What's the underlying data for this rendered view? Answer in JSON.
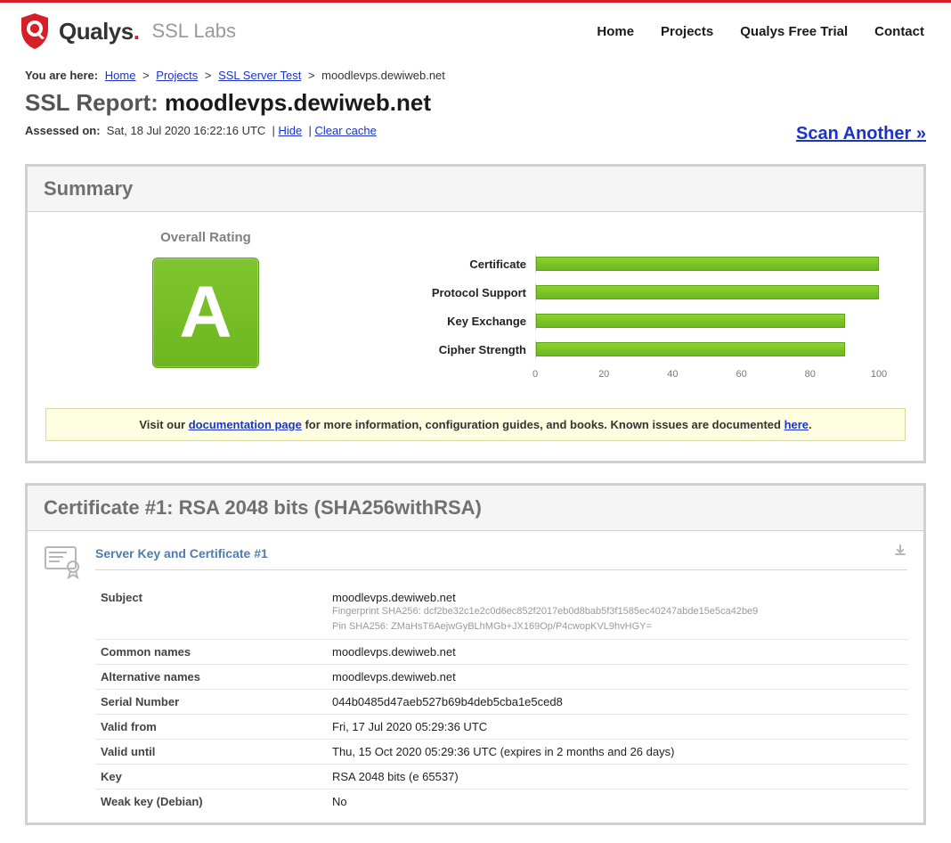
{
  "nav": {
    "home": "Home",
    "projects": "Projects",
    "trial": "Qualys Free Trial",
    "contact": "Contact"
  },
  "brand": {
    "qualys": "Qualys",
    "ssllabs": "SSL Labs"
  },
  "crumbs": {
    "label": "You are here:",
    "home": "Home",
    "projects": "Projects",
    "ssl_test": "SSL Server Test",
    "current": "moodlevps.dewiweb.net"
  },
  "report": {
    "prefix": "SSL Report: ",
    "host": "moodlevps.dewiweb.net",
    "assessed_label": "Assessed on:",
    "assessed_time": "Sat, 18 Jul 2020 16:22:16 UTC",
    "hide": "Hide",
    "clear_cache": "Clear cache",
    "scan_another": "Scan Another »"
  },
  "summary": {
    "title": "Summary",
    "overall_rating_label": "Overall Rating",
    "grade": "A",
    "visit_pre": "Visit our ",
    "doc_link": "documentation page",
    "visit_mid": " for more information, configuration guides, and books. Known issues are documented ",
    "here_link": "here",
    "visit_end": "."
  },
  "chart_data": {
    "type": "bar",
    "categories": [
      "Certificate",
      "Protocol Support",
      "Key Exchange",
      "Cipher Strength"
    ],
    "values": [
      100,
      100,
      90,
      90
    ],
    "xlabel": "",
    "ylabel": "",
    "xlim": [
      0,
      100
    ],
    "ticks": [
      0,
      20,
      40,
      60,
      80,
      100
    ]
  },
  "certificate": {
    "header": "Certificate #1: RSA 2048 bits (SHA256withRSA)",
    "section_title": "Server Key and Certificate #1",
    "rows": {
      "subject_label": "Subject",
      "subject_value": "moodlevps.dewiweb.net",
      "subject_fp": "Fingerprint SHA256: dcf2be32c1e2c0d6ec852f2017eb0d8bab5f3f1585ec40247abde15e5ca42be9",
      "subject_pin": "Pin SHA256: ZMaHsT6AejwGyBLhMGb+JX169Op/P4cwopKVL9hvHGY=",
      "common_names_label": "Common names",
      "common_names_value": "moodlevps.dewiweb.net",
      "alt_names_label": "Alternative names",
      "alt_names_value": "moodlevps.dewiweb.net",
      "serial_label": "Serial Number",
      "serial_value": "044b0485d47aeb527b69b4deb5cba1e5ced8",
      "valid_from_label": "Valid from",
      "valid_from_value": "Fri, 17 Jul 2020 05:29:36 UTC",
      "valid_until_label": "Valid until",
      "valid_until_value": "Thu, 15 Oct 2020 05:29:36 UTC (expires in 2 months and 26 days)",
      "key_label": "Key",
      "key_value": "RSA 2048 bits (e 65537)",
      "weak_key_label": "Weak key (Debian)",
      "weak_key_value": "No"
    }
  }
}
